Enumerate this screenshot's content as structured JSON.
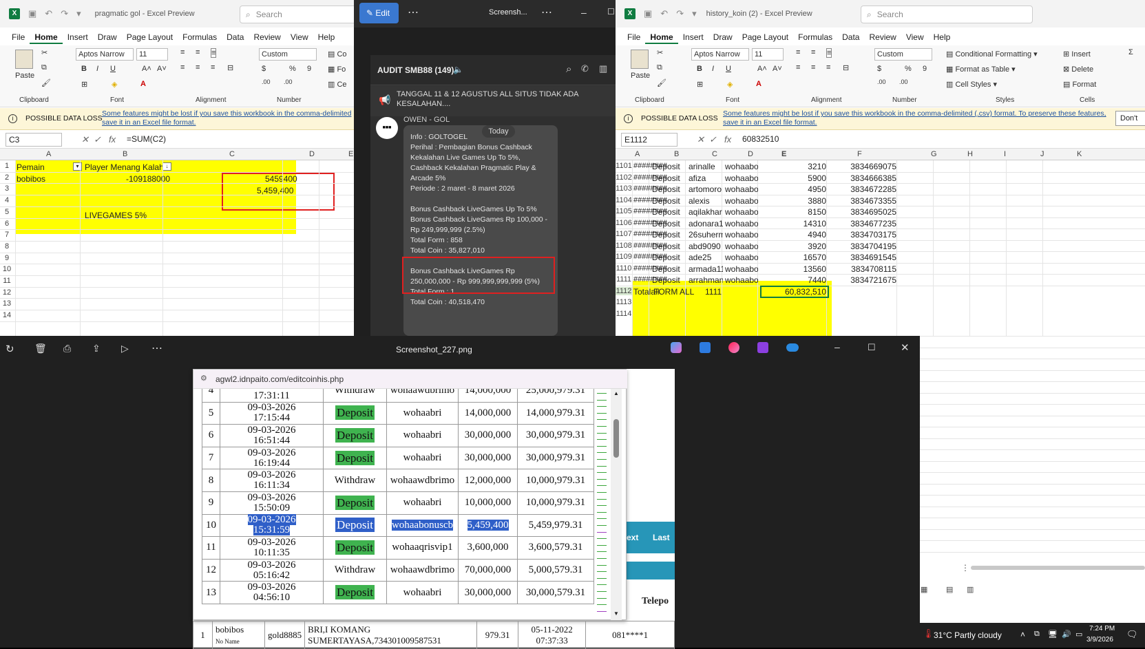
{
  "left_excel": {
    "title": "pragmatic gol  -  Excel Preview",
    "search": "Search",
    "menu": [
      "File",
      "Home",
      "Insert",
      "Draw",
      "Page Layout",
      "Formulas",
      "Data",
      "Review",
      "View",
      "Help"
    ],
    "font_name": "Aptos Narrow",
    "font_size": "11",
    "number_format": "Custom",
    "paste": "Paste",
    "groups": [
      "Clipboard",
      "Font",
      "Alignment",
      "Number"
    ],
    "warn_title": "POSSIBLE DATA LOSS",
    "warn_text1": "Some features might be lost if you save this workbook in the comma-delimited",
    "warn_text2": "save it in an Excel file format.",
    "namebox": "C3",
    "formula": "=SUM(C2)",
    "cols": [
      "A",
      "B",
      "C",
      "D",
      "E"
    ],
    "rows": [
      "1",
      "2",
      "3",
      "4",
      "5",
      "6",
      "7",
      "8",
      "9",
      "10",
      "11",
      "12",
      "13",
      "14"
    ],
    "a1": "Pemain",
    "b1": "Player Menang Kalah",
    "a2": "bobibos",
    "b2": "-109188000",
    "c2": "5459400",
    "c3": "5,459,400",
    "b5": "LIVEGAMES 5%"
  },
  "chat": {
    "edit": "Edit",
    "title": "Screensh...",
    "channel": "AUDIT SMB88 (149)",
    "pinned": "TANGGAL 11 & 12 AGUSTUS ALL SITUS TIDAK ADA KESALAHAN....",
    "sender": "OWEN - GOL",
    "today": "Today",
    "lines": [
      "Info : GOLTOGEL",
      "Perihal : Pembagian Bonus Cashback",
      "Kekalahan Live Games Up To 5%,",
      "Cashback Kekalahan Pragmatic Play &",
      "Arcade 5%",
      "Periode : 2 maret - 8 maret 2026",
      "",
      "Bonus Cashback LiveGames Up To 5%",
      "Bonus Cashback LiveGames Rp 100,000 -",
      "Rp 249,999,999 (2.5%)",
      "Total Form : 858",
      "Total Coin : 35,827,010",
      "",
      "Bonus Cashback LiveGames Rp",
      "250,000,000 - Rp 999,999,999,999  (5%)",
      "Total Form : 1",
      "Total Coin : 40,518,470"
    ]
  },
  "right_excel": {
    "title": "history_koin (2)  -  Excel Preview",
    "search": "Search",
    "menu": [
      "File",
      "Home",
      "Insert",
      "Draw",
      "Page Layout",
      "Formulas",
      "Data",
      "Review",
      "View",
      "Help"
    ],
    "font_name": "Aptos Narrow",
    "font_size": "11",
    "number_format": "Custom",
    "paste": "Paste",
    "groups": [
      "Clipboard",
      "Font",
      "Alignment",
      "Number",
      "Styles",
      "Cells"
    ],
    "styles": [
      "Conditional Formatting",
      "Format as Table",
      "Cell Styles"
    ],
    "cells": [
      "Insert",
      "Delete",
      "Format"
    ],
    "warn_title": "POSSIBLE DATA LOSS",
    "warn_text1": "Some features might be lost if you save this workbook in the comma-delimited (.csv) format. To preserve these features,",
    "warn_text2": "save it in an Excel file format.",
    "dont": "Don't",
    "namebox": "E1112",
    "formula": "60832510",
    "cols": [
      "A",
      "B",
      "C",
      "D",
      "E",
      "F",
      "G",
      "H",
      "I",
      "J",
      "K"
    ],
    "rows": [
      {
        "n": "1101",
        "a": "########",
        "b": "Deposit",
        "c": "arinalle",
        "d": "wohaabor",
        "e": "3210",
        "f": "3834669075"
      },
      {
        "n": "1102",
        "a": "########",
        "b": "Deposit",
        "c": "afiza",
        "d": "wohaabor",
        "e": "5900",
        "f": "3834666385"
      },
      {
        "n": "1103",
        "a": "########",
        "b": "Deposit",
        "c": "artomoro",
        "d": "wohaabor",
        "e": "4950",
        "f": "3834672285"
      },
      {
        "n": "1104",
        "a": "########",
        "b": "Deposit",
        "c": "alexis",
        "d": "wohaabor",
        "e": "3880",
        "f": "3834673355"
      },
      {
        "n": "1105",
        "a": "########",
        "b": "Deposit",
        "c": "aqilakhar",
        "d": "wohaabor",
        "e": "8150",
        "f": "3834695025"
      },
      {
        "n": "1106",
        "a": "########",
        "b": "Deposit",
        "c": "adonara1:",
        "d": "wohaabor",
        "e": "14310",
        "f": "3834677235"
      },
      {
        "n": "1107",
        "a": "########",
        "b": "Deposit",
        "c": "26suherm",
        "d": "wohaabor",
        "e": "4940",
        "f": "3834703175"
      },
      {
        "n": "1108",
        "a": "########",
        "b": "Deposit",
        "c": "abd9090",
        "d": "wohaabor",
        "e": "3920",
        "f": "3834704195"
      },
      {
        "n": "1109",
        "a": "########",
        "b": "Deposit",
        "c": "ade25",
        "d": "wohaabor",
        "e": "16570",
        "f": "3834691545"
      },
      {
        "n": "1110",
        "a": "########",
        "b": "Deposit",
        "c": "armada11",
        "d": "wohaabor",
        "e": "13560",
        "f": "3834708115"
      },
      {
        "n": "1111",
        "a": "########",
        "b": "Deposit",
        "c": "arrahman",
        "d": "wohaabor",
        "e": "7440",
        "f": "3834721675"
      }
    ],
    "total_row": {
      "n": "1112",
      "a": "Totalall",
      "b": "FORM ALL",
      "c": "1111",
      "e": "60,832,510"
    },
    "empty_rows": [
      "1113",
      "1114"
    ]
  },
  "viewer": {
    "title": "Screenshot_227.png",
    "url": "agwl2.idnpaito.com/editcoinhis.php",
    "rows": [
      {
        "no": "4",
        "date": "09-03-2026",
        "time": "17:31:11",
        "type": "Withdraw",
        "user": "wohaawdbrimo",
        "amt": "14,000,000",
        "bal": "25,000,979.31"
      },
      {
        "no": "5",
        "date": "09-03-2026",
        "time": "17:15:44",
        "type": "Deposit",
        "user": "wohaabri",
        "amt": "14,000,000",
        "bal": "14,000,979.31"
      },
      {
        "no": "6",
        "date": "09-03-2026",
        "time": "16:51:44",
        "type": "Deposit",
        "user": "wohaabri",
        "amt": "30,000,000",
        "bal": "30,000,979.31"
      },
      {
        "no": "7",
        "date": "09-03-2026",
        "time": "16:19:44",
        "type": "Deposit",
        "user": "wohaabri",
        "amt": "30,000,000",
        "bal": "30,000,979.31"
      },
      {
        "no": "8",
        "date": "09-03-2026",
        "time": "16:11:34",
        "type": "Withdraw",
        "user": "wohaawdbrimo",
        "amt": "12,000,000",
        "bal": "10,000,979.31"
      },
      {
        "no": "9",
        "date": "09-03-2026",
        "time": "15:50:09",
        "type": "Deposit",
        "user": "wohaabri",
        "amt": "10,000,000",
        "bal": "10,000,979.31"
      },
      {
        "no": "10",
        "date": "09-03-2026",
        "time": "15:31:59",
        "type": "Deposit",
        "user": "wohaabonuscb",
        "amt": "5,459,400",
        "bal": "5,459,979.31"
      },
      {
        "no": "11",
        "date": "09-03-2026",
        "time": "10:11:35",
        "type": "Deposit",
        "user": "wohaaqrisvip1",
        "amt": "3,600,000",
        "bal": "3,600,579.31"
      },
      {
        "no": "12",
        "date": "09-03-2026",
        "time": "05:16:42",
        "type": "Withdraw",
        "user": "wohaawdbrimo",
        "amt": "70,000,000",
        "bal": "5,000,579.31"
      },
      {
        "no": "13",
        "date": "09-03-2026",
        "time": "04:56:10",
        "type": "Deposit",
        "user": "wohaabri",
        "amt": "30,000,000",
        "bal": "30,000,579.31"
      }
    ],
    "bottom": {
      "no": "1",
      "user": "bobibos",
      "sub": "No Name",
      "code": "gold8885",
      "bank": "BRI,I KOMANG",
      "bank2": "SUMERTAYASA,734301009587531",
      "amt": "979.31",
      "date": "05-11-2022",
      "time": "07:37:33",
      "phone": "081****1"
    },
    "side_next": "ext",
    "side_last": "Last",
    "side_tele": "Telepo"
  },
  "taskbar": {
    "weather": "31°C  Partly cloudy",
    "time": "7:24 PM",
    "date": "3/9/2026"
  }
}
